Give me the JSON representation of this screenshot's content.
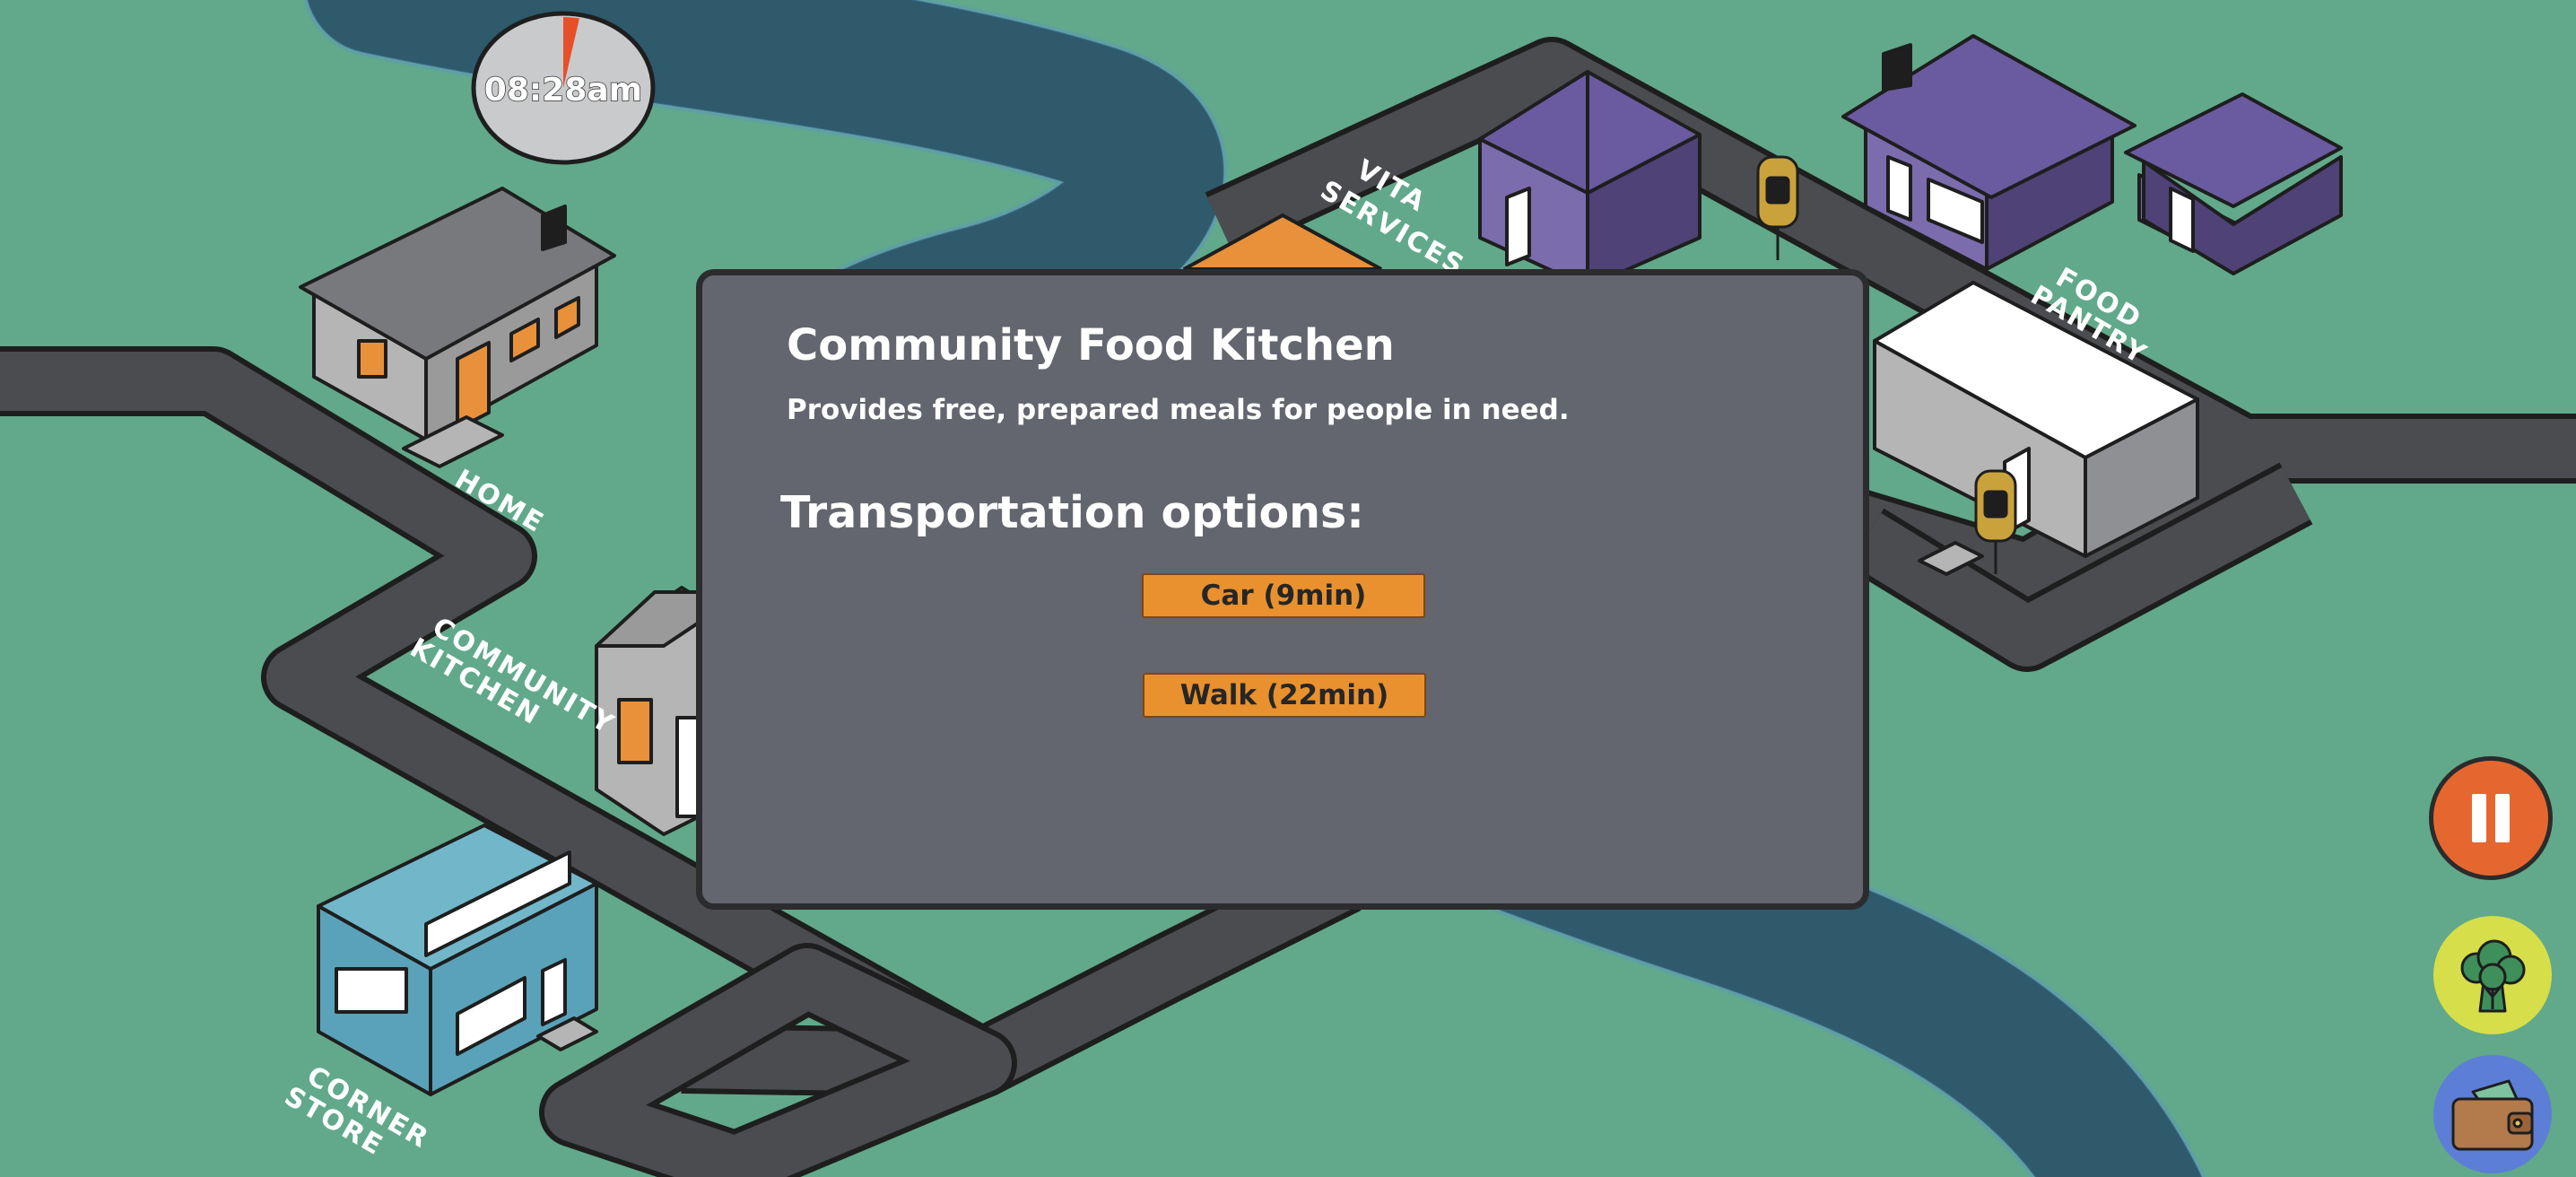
{
  "clock": {
    "time": "08:28am",
    "day_progress": 0.03
  },
  "map_labels": {
    "home": "HOME",
    "community_kitchen": [
      "COMMUNITY",
      "KITCHEN"
    ],
    "corner_store": [
      "CORNER",
      "STORE"
    ],
    "vita_services": [
      "VITA",
      "SERVICES"
    ],
    "food_pantry": [
      "FOOD",
      "PANTRY"
    ]
  },
  "modal": {
    "title": "Community Food Kitchen",
    "description": "Provides free, prepared meals for people in need.",
    "transport_heading": "Transportation options:",
    "options": [
      {
        "label": "Car (9min)"
      },
      {
        "label": "Walk (22min)"
      }
    ]
  },
  "side_buttons": {
    "pause": "pause-icon",
    "food": "broccoli-icon",
    "wallet": "wallet-icon"
  },
  "colors": {
    "grass": "#61a98a",
    "river": "#2e5a6b",
    "road": "#4b4c50",
    "modal_bg": "#63656f",
    "option_button": "#e9912e",
    "pause_button": "#e5672f",
    "food_button": "#d6de4a",
    "wallet_button": "#5d7ed6"
  }
}
